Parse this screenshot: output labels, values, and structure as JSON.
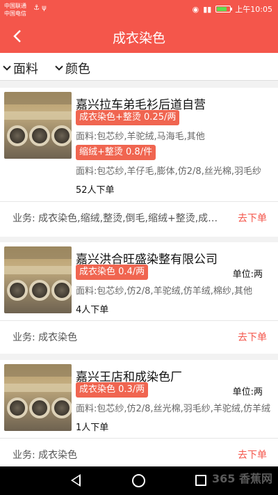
{
  "status_bar": {
    "carrier1": "中国联通",
    "carrier2": "中国电信",
    "time": "上午10:05"
  },
  "header": {
    "title": "成衣染色"
  },
  "filters": [
    {
      "label": "面料"
    },
    {
      "label": "颜色"
    }
  ],
  "cards": [
    {
      "name": "嘉兴拉车弟毛衫后道自营",
      "services": [
        {
          "tag": "成衣染色+整烫 0.25/两",
          "material": "面料:包芯纱,羊驼绒,马海毛,其他"
        },
        {
          "tag": "缩绒+整烫 0.8/件",
          "material": "面料:包芯纱,羊仔毛,膨体,仿2/8,丝光棉,羽毛纱"
        }
      ],
      "orders": "52人下单",
      "business": "业务:  成衣染色,缩绒,整烫,倒毛,缩绒+整烫,成衣染色+整烫",
      "action": "去下单"
    },
    {
      "name": "嘉兴洪合旺盛染整有限公司",
      "unit": "单位:两",
      "services": [
        {
          "tag": "成衣染色 0.4/两",
          "material": "面料:包芯纱,仿2/8,羊驼绒,仿羊绒,棉纱,其他"
        }
      ],
      "orders": "4人下单",
      "business": "业务:  成衣染色",
      "action": "去下单"
    },
    {
      "name": "嘉兴王店和成染色厂",
      "unit": "单位:两",
      "services": [
        {
          "tag": "成衣染色 0.3/两",
          "material": "面料:包芯纱,仿2/8,丝光棉,羽毛纱,羊驼绒,仿羊绒"
        }
      ],
      "orders": "1人下单",
      "business": "业务:  成衣染色",
      "action": "去下单"
    }
  ],
  "watermark": "365 香蕉网"
}
